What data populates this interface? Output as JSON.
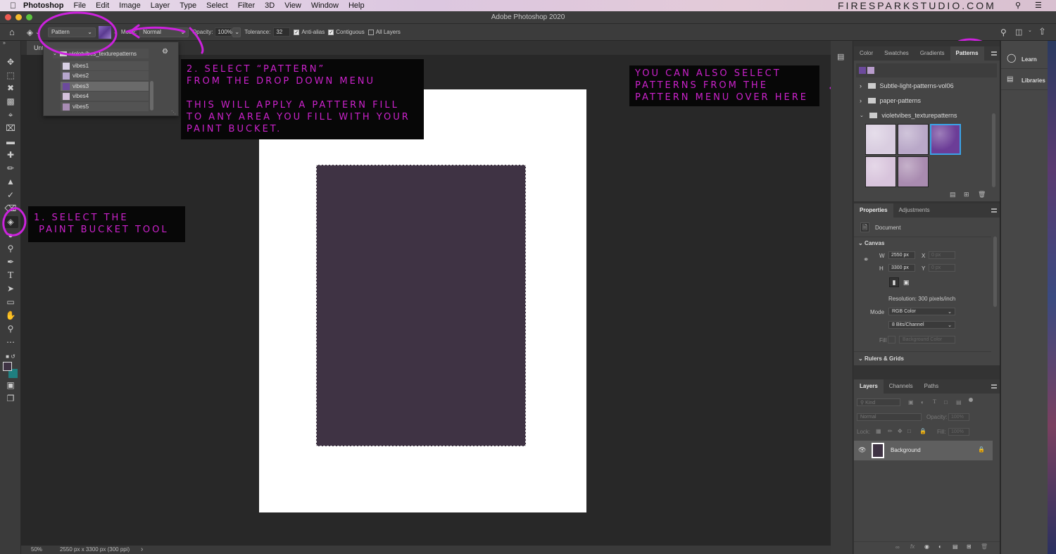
{
  "menubar": {
    "app": "Photoshop",
    "items": [
      "File",
      "Edit",
      "Image",
      "Layer",
      "Type",
      "Select",
      "Filter",
      "3D",
      "View",
      "Window",
      "Help"
    ],
    "brand": "FIRESPARKSTUDIO.COM"
  },
  "window": {
    "title": "Adobe Photoshop 2020"
  },
  "options": {
    "fill_source": "Pattern",
    "mode_label": "Mode:",
    "mode": "Normal",
    "opacity_label": "Opacity:",
    "opacity": "100%",
    "tolerance_label": "Tolerance:",
    "tolerance": "32",
    "anti_alias": "Anti-alias",
    "contiguous": "Contiguous",
    "all_layers": "All Layers"
  },
  "doc_tab": {
    "label": "Unt"
  },
  "pattern_popup": {
    "folder": "violetvibes_texturepatterns",
    "items": [
      "vibes1",
      "vibes2",
      "vibes3",
      "vibes4",
      "vibes5"
    ],
    "selected": "vibes3"
  },
  "annotations": {
    "step1": "1. SELECT THE\n PAINT BUCKET TOOL",
    "step2": "2. SELECT “PATTERN”\nFROM THE DROP DOWN MENU\n\nTHIS WILL APPLY A PATTERN FILL\nTO ANY AREA YOU FILL WITH YOUR\nPAINT BUCKET.",
    "step3": "YOU CAN ALSO SELECT\nPATTERNS FROM THE\nPATTERN MENU OVER HERE"
  },
  "status": {
    "zoom": "50%",
    "doc_info": "2550 px x 3300 px (300 ppi)",
    "arrow": "›"
  },
  "patterns_panel": {
    "tabs": [
      "Color",
      "Swatches",
      "Gradients",
      "Patterns"
    ],
    "active_tab": "Patterns",
    "folders": [
      {
        "name": "Subtle-light-patterns-vol06",
        "expanded": false
      },
      {
        "name": "paper-patterns",
        "expanded": false
      },
      {
        "name": "violetvibes_texturepatterns",
        "expanded": true
      }
    ],
    "swatch_colors": [
      "#d9cde0",
      "#b9a8c8",
      "#6c3d97",
      "#d8c4dc",
      "#a98bb0"
    ],
    "selected_swatch": 2
  },
  "properties_panel": {
    "tabs": [
      "Properties",
      "Adjustments"
    ],
    "section": "Document",
    "canvas_label": "Canvas",
    "w_label": "W",
    "w": "2550 px",
    "h_label": "H",
    "h": "3300 px",
    "x_label": "X",
    "x": "0 px",
    "y_label": "Y",
    "y": "0 px",
    "resolution": "Resolution: 300 pixels/inch",
    "mode_label": "Mode",
    "mode": "RGB Color",
    "bits": "8 Bits/Channel",
    "fill_label": "Fill",
    "fill": "Background Color",
    "rulers": "Rulers & Grids"
  },
  "layers_panel": {
    "tabs": [
      "Layers",
      "Channels",
      "Paths"
    ],
    "kind": "Kind",
    "blend": "Normal",
    "opacity_label": "Opacity:",
    "opacity": "100%",
    "lock_label": "Lock:",
    "fill_label": "Fill:",
    "fill": "100%",
    "layers": [
      {
        "name": "Background",
        "visible": true,
        "locked": true
      }
    ]
  },
  "side_panel": {
    "learn": "Learn",
    "libraries": "Libraries"
  },
  "colors": {
    "foreground": "#3f3344",
    "background": "#1f7f80",
    "accent": "#cc22cc"
  }
}
